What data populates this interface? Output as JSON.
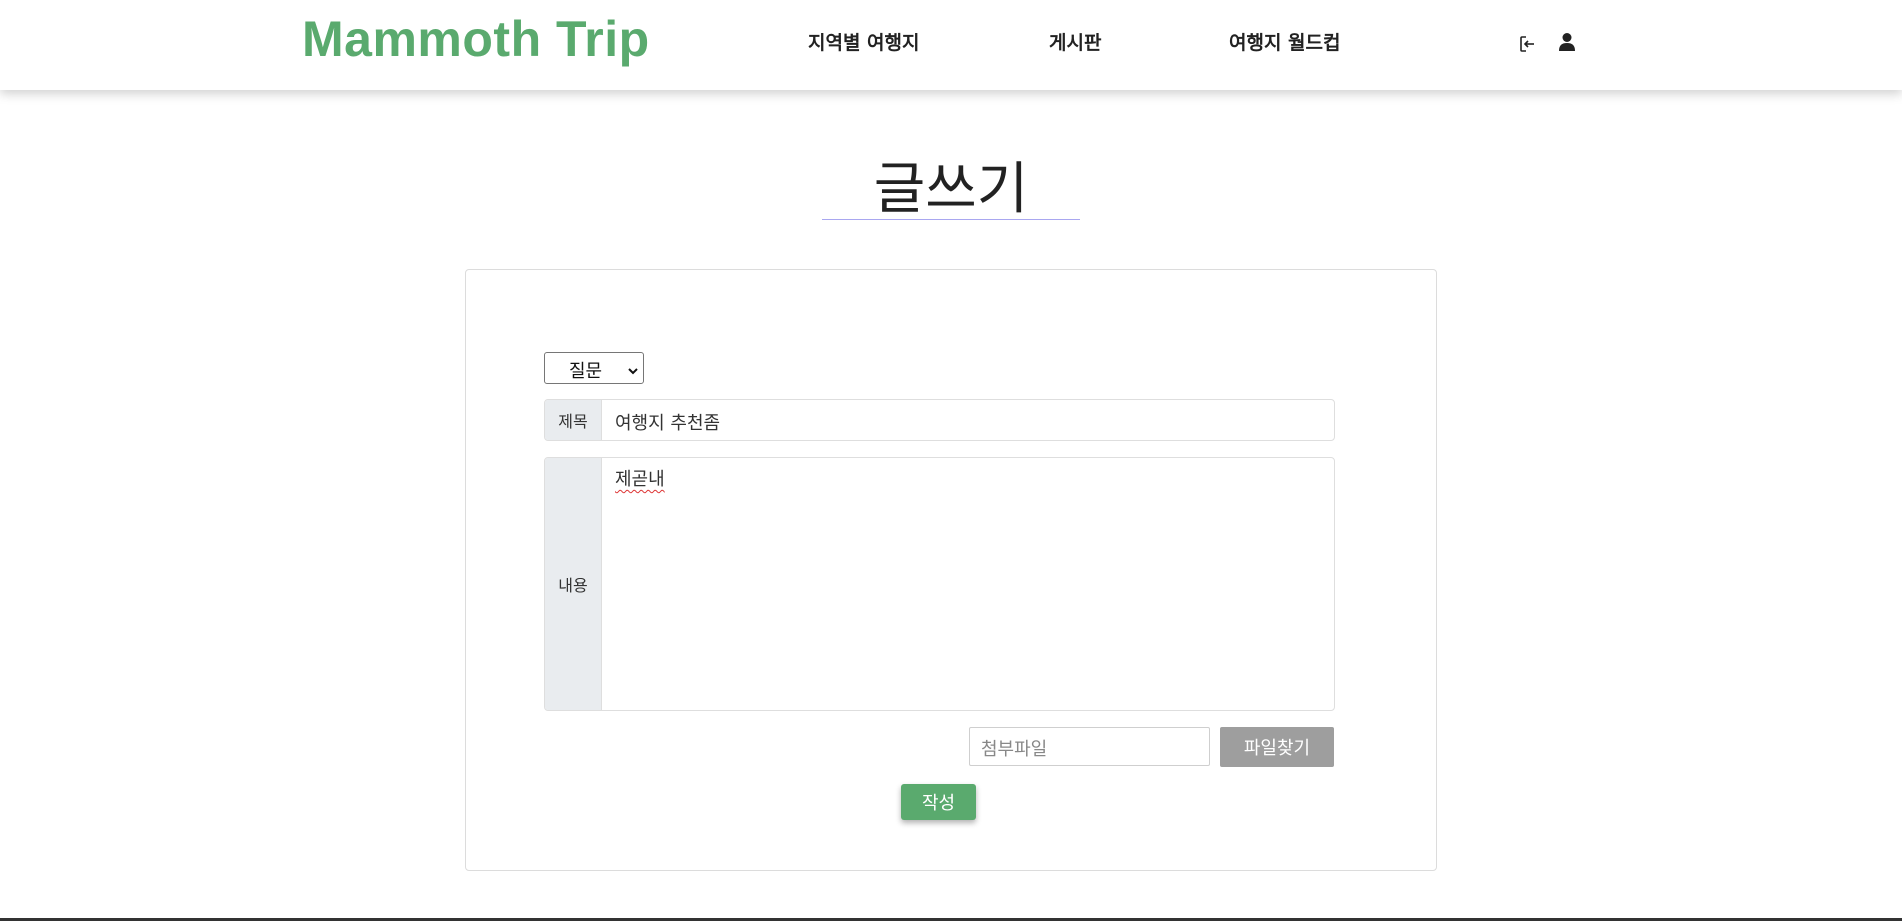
{
  "header": {
    "logo": "Mammoth Trip",
    "nav": [
      "지역별 여행지",
      "게시판",
      "여행지 월드컵"
    ],
    "icons": {
      "login": "login-icon",
      "user": "user-icon"
    },
    "brand_color": "#5aaa6e"
  },
  "page": {
    "title": "글쓰기"
  },
  "form": {
    "category": {
      "selected": "질문"
    },
    "title_field": {
      "label": "제목",
      "value": "여행지 추천좀"
    },
    "content_field": {
      "label": "내용",
      "value": "제곧내"
    },
    "file": {
      "placeholder": "첨부파일",
      "button_label": "파일찾기"
    },
    "submit_label": "작성"
  }
}
